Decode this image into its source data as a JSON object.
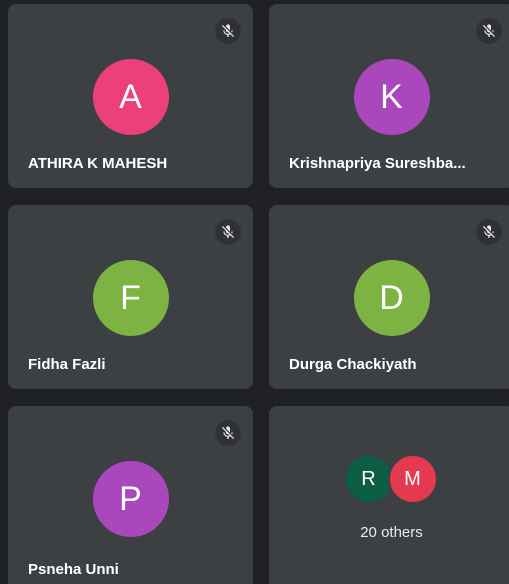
{
  "colors": {
    "background": "#202124",
    "tile": "#3c4043",
    "avatar_pink": "#ec407a",
    "avatar_purple": "#ab47bc",
    "avatar_green": "#7cb342",
    "avatar_dark_green": "#0b5d44",
    "avatar_red": "#e53950"
  },
  "participants": [
    {
      "initial": "A",
      "name": "ATHIRA K MAHESH",
      "muted": true,
      "mic_icon": "mic-off-icon",
      "color": "#ec407a"
    },
    {
      "initial": "K",
      "name": "Krishnapriya Sureshba...",
      "muted": true,
      "mic_icon": "mic-off-icon",
      "color": "#ab47bc"
    },
    {
      "initial": "F",
      "name": "Fidha Fazli",
      "muted": true,
      "mic_icon": "mic-off-icon",
      "color": "#7cb342"
    },
    {
      "initial": "D",
      "name": "Durga Chackiyath",
      "muted": true,
      "mic_icon": "mic-off-icon",
      "color": "#7cb342"
    },
    {
      "initial": "P",
      "name": "Psneha Unni",
      "muted": true,
      "mic_icon": "mic-off-icon",
      "color": "#ab47bc"
    }
  ],
  "others": {
    "avatars": [
      {
        "initial": "R",
        "color": "#0b5d44"
      },
      {
        "initial": "M",
        "color": "#e53950"
      }
    ],
    "label": "20 others"
  }
}
